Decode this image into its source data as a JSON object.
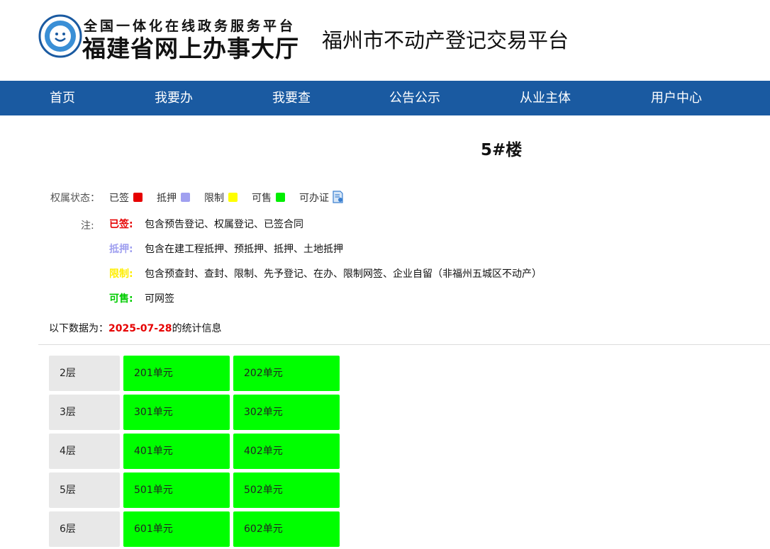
{
  "header": {
    "logo_top": "全国一体化在线政务服务平台",
    "logo_main": "福建省网上办事大厅",
    "platform_title": "福州市不动产登记交易平台",
    "logo_icon": "fujian-hall-emblem-icon"
  },
  "nav": {
    "items": [
      {
        "label": "首页"
      },
      {
        "label": "我要办"
      },
      {
        "label": "我要查"
      },
      {
        "label": "公告公示"
      },
      {
        "label": "从业主体"
      },
      {
        "label": "用户中心"
      }
    ],
    "bg_color": "#1a5aa1"
  },
  "building": {
    "title": "5#楼"
  },
  "legend": {
    "label": "权属状态：",
    "items": [
      {
        "label": "已签",
        "color": "#e60000"
      },
      {
        "label": "抵押",
        "color": "#a0a0f0"
      },
      {
        "label": "限制",
        "color": "#ffff00"
      },
      {
        "label": "可售",
        "color": "#00ee00"
      },
      {
        "label": "可办证",
        "icon": "certificate-icon"
      }
    ]
  },
  "notes": {
    "label": "注:",
    "items": [
      {
        "term": "已签:",
        "desc": "包含预告登记、权属登记、已签合同",
        "color": "#e60000"
      },
      {
        "term": "抵押:",
        "desc": "包含在建工程抵押、预抵押、抵押、土地抵押",
        "color": "#a0a0f0"
      },
      {
        "term": "限制:",
        "desc": "包含预查封、查封、限制、先予登记、在办、限制网签、企业自留（非福州五城区不动产）",
        "color": "#ffff00"
      },
      {
        "term": "可售:",
        "desc": "可网签",
        "color": "#00ee00"
      }
    ]
  },
  "stats": {
    "prefix": "以下数据为：",
    "date": "2025-07-28",
    "suffix": "的统计信息"
  },
  "floors": [
    {
      "label": "2层",
      "units": [
        "201单元",
        "202单元"
      ]
    },
    {
      "label": "3层",
      "units": [
        "301单元",
        "302单元"
      ]
    },
    {
      "label": "4层",
      "units": [
        "401单元",
        "402单元"
      ]
    },
    {
      "label": "5层",
      "units": [
        "501单元",
        "502单元"
      ]
    },
    {
      "label": "6层",
      "units": [
        "601单元",
        "602单元"
      ]
    }
  ],
  "unit_status_color": "#00ff00"
}
